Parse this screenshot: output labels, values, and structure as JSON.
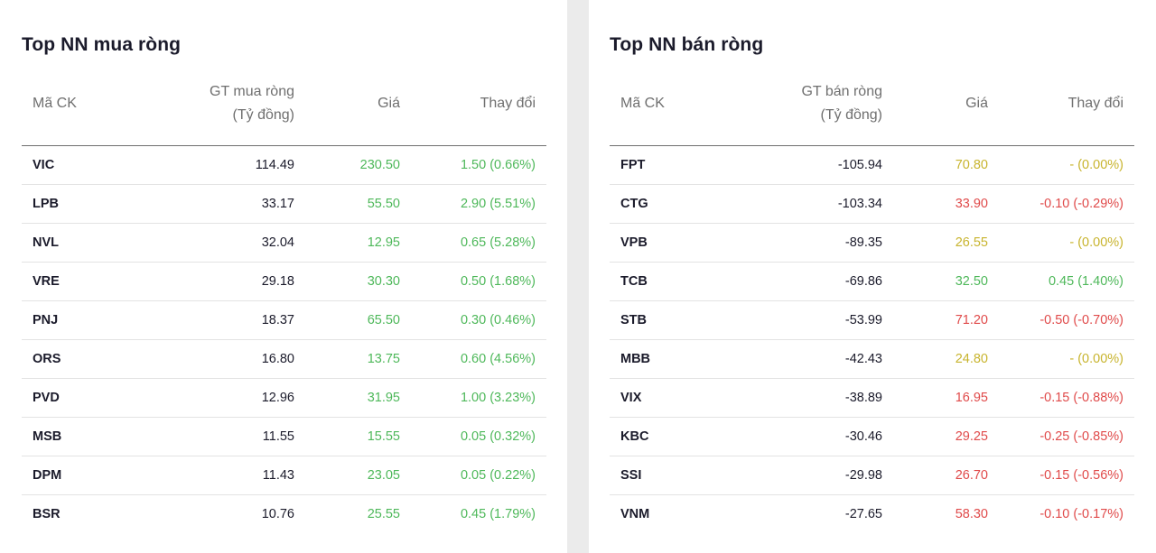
{
  "colors": {
    "up": "#4eb85a",
    "down": "#e04a4a",
    "ref": "#c8b42e"
  },
  "buy": {
    "title": "Top NN mua ròng",
    "headers": {
      "symbol": "Mã CK",
      "value_line1": "GT mua ròng",
      "value_line2": "(Tỷ đồng)",
      "price": "Giá",
      "change": "Thay đổi"
    },
    "rows": [
      {
        "symbol": "VIC",
        "value": "114.49",
        "price": "230.50",
        "change": "1.50 (0.66%)",
        "trend": "up"
      },
      {
        "symbol": "LPB",
        "value": "33.17",
        "price": "55.50",
        "change": "2.90 (5.51%)",
        "trend": "up"
      },
      {
        "symbol": "NVL",
        "value": "32.04",
        "price": "12.95",
        "change": "0.65 (5.28%)",
        "trend": "up"
      },
      {
        "symbol": "VRE",
        "value": "29.18",
        "price": "30.30",
        "change": "0.50 (1.68%)",
        "trend": "up"
      },
      {
        "symbol": "PNJ",
        "value": "18.37",
        "price": "65.50",
        "change": "0.30 (0.46%)",
        "trend": "up"
      },
      {
        "symbol": "ORS",
        "value": "16.80",
        "price": "13.75",
        "change": "0.60 (4.56%)",
        "trend": "up"
      },
      {
        "symbol": "PVD",
        "value": "12.96",
        "price": "31.95",
        "change": "1.00 (3.23%)",
        "trend": "up"
      },
      {
        "symbol": "MSB",
        "value": "11.55",
        "price": "15.55",
        "change": "0.05 (0.32%)",
        "trend": "up"
      },
      {
        "symbol": "DPM",
        "value": "11.43",
        "price": "23.05",
        "change": "0.05 (0.22%)",
        "trend": "up"
      },
      {
        "symbol": "BSR",
        "value": "10.76",
        "price": "25.55",
        "change": "0.45 (1.79%)",
        "trend": "up"
      }
    ]
  },
  "sell": {
    "title": "Top NN bán ròng",
    "headers": {
      "symbol": "Mã CK",
      "value_line1": "GT bán ròng",
      "value_line2": "(Tỷ đồng)",
      "price": "Giá",
      "change": "Thay đổi"
    },
    "rows": [
      {
        "symbol": "FPT",
        "value": "-105.94",
        "price": "70.80",
        "change": "- (0.00%)",
        "trend": "ref"
      },
      {
        "symbol": "CTG",
        "value": "-103.34",
        "price": "33.90",
        "change": "-0.10 (-0.29%)",
        "trend": "down"
      },
      {
        "symbol": "VPB",
        "value": "-89.35",
        "price": "26.55",
        "change": "- (0.00%)",
        "trend": "ref"
      },
      {
        "symbol": "TCB",
        "value": "-69.86",
        "price": "32.50",
        "change": "0.45 (1.40%)",
        "trend": "up"
      },
      {
        "symbol": "STB",
        "value": "-53.99",
        "price": "71.20",
        "change": "-0.50 (-0.70%)",
        "trend": "down"
      },
      {
        "symbol": "MBB",
        "value": "-42.43",
        "price": "24.80",
        "change": "- (0.00%)",
        "trend": "ref"
      },
      {
        "symbol": "VIX",
        "value": "-38.89",
        "price": "16.95",
        "change": "-0.15 (-0.88%)",
        "trend": "down"
      },
      {
        "symbol": "KBC",
        "value": "-30.46",
        "price": "29.25",
        "change": "-0.25 (-0.85%)",
        "trend": "down"
      },
      {
        "symbol": "SSI",
        "value": "-29.98",
        "price": "26.70",
        "change": "-0.15 (-0.56%)",
        "trend": "down"
      },
      {
        "symbol": "VNM",
        "value": "-27.65",
        "price": "58.30",
        "change": "-0.10 (-0.17%)",
        "trend": "down"
      }
    ]
  }
}
